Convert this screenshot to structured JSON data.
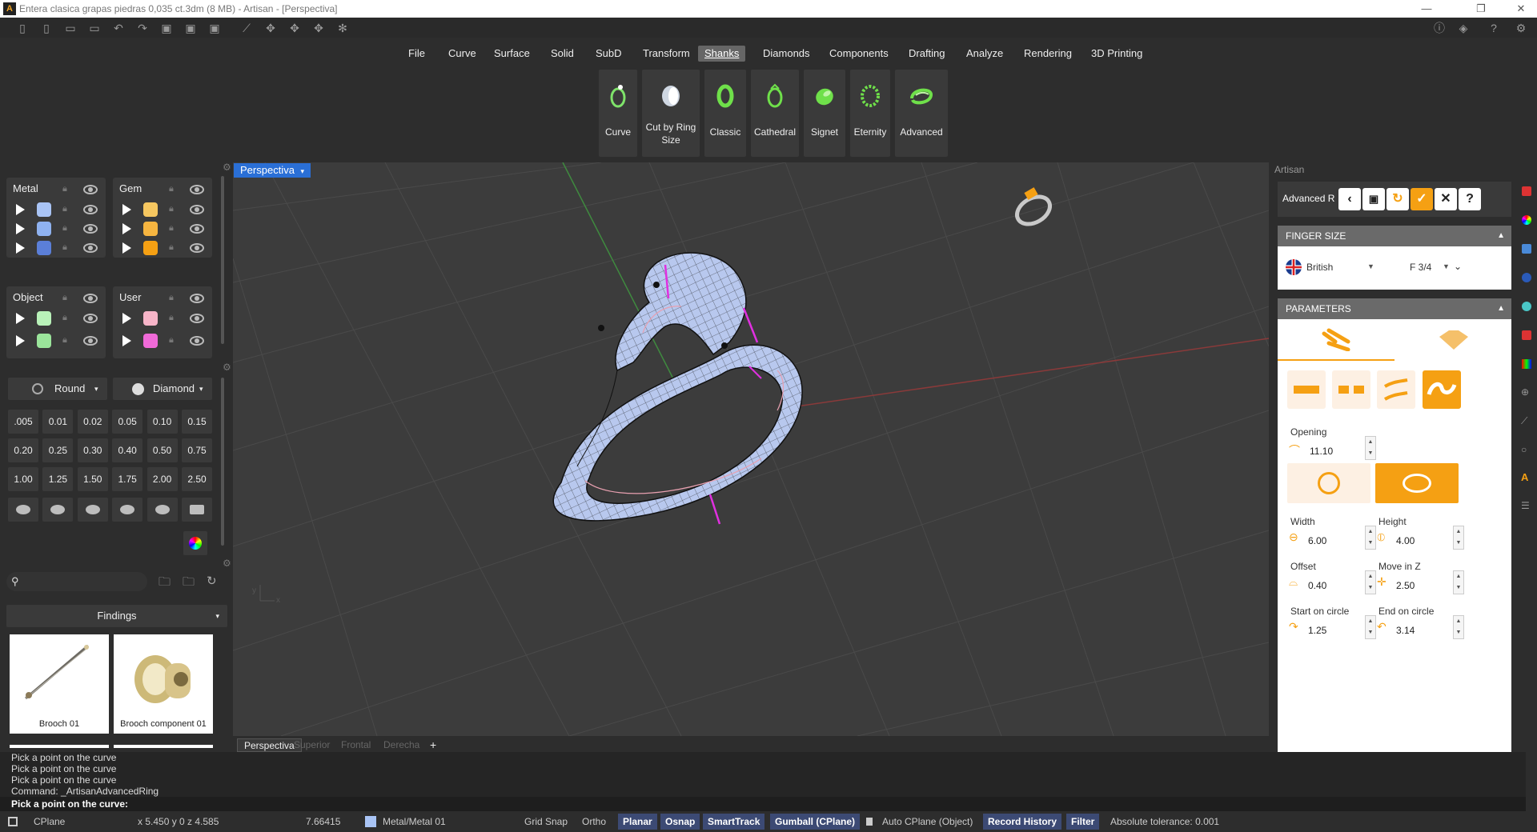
{
  "titlebar": {
    "title": "Entera clasica grapas piedras 0,035 ct.3dm (8 MB) - Artisan - [Perspectiva]"
  },
  "menu": [
    "File",
    "Curve",
    "Surface",
    "Solid",
    "SubD",
    "Transform",
    "Shanks",
    "Diamonds",
    "Components",
    "Drafting",
    "Analyze",
    "Rendering",
    "3D Printing"
  ],
  "menu_active": "Shanks",
  "ribbon": [
    {
      "label": "Curve",
      "icon": "ring-curve-icon"
    },
    {
      "label": "Cut by Ring Size",
      "icon": "ring-cut-icon"
    },
    {
      "label": "Classic",
      "icon": "ring-classic-icon"
    },
    {
      "label": "Cathedral",
      "icon": "ring-cathedral-icon"
    },
    {
      "label": "Signet",
      "icon": "ring-signet-icon"
    },
    {
      "label": "Eternity",
      "icon": "ring-eternity-icon"
    },
    {
      "label": "Advanced",
      "icon": "ring-advanced-icon"
    }
  ],
  "layers": {
    "metal": {
      "label": "Metal",
      "colors": [
        "#a9c4f5",
        "#8fb2f0",
        "#5b7fd8"
      ]
    },
    "gem": {
      "label": "Gem",
      "colors": [
        "#f6c760",
        "#f6b540",
        "#f5a013"
      ]
    },
    "object": {
      "label": "Object",
      "colors": [
        "#b9f2b9",
        "#9be59b"
      ]
    },
    "user": {
      "label": "User",
      "colors": [
        "#f7b5c8",
        "#f06ad8"
      ]
    }
  },
  "gems": {
    "shape": "Round",
    "cut": "Diamond",
    "sizes": [
      ".005",
      "0.01",
      "0.02",
      "0.05",
      "0.10",
      "0.15",
      "0.20",
      "0.25",
      "0.30",
      "0.40",
      "0.50",
      "0.75",
      "1.00",
      "1.25",
      "1.50",
      "1.75",
      "2.00",
      "2.50"
    ]
  },
  "library": {
    "category": "Findings",
    "items": [
      {
        "label": "Brooch 01"
      },
      {
        "label": "Brooch component 01"
      }
    ]
  },
  "viewport": {
    "name": "Perspectiva",
    "tabs": [
      "Perspectiva",
      "Superior",
      "Frontal",
      "Derecha"
    ],
    "active_tab": "Perspectiva",
    "axis_x": "x",
    "axis_y": "y"
  },
  "artisan": {
    "panel_title": "Artisan",
    "mode": "Advanced R",
    "finger_size": {
      "header": "FINGER SIZE",
      "system": "British",
      "size": "F 3/4"
    },
    "parameters": {
      "header": "PARAMETERS",
      "opening": {
        "label": "Opening",
        "value": "11.10"
      },
      "width": {
        "label": "Width",
        "value": "6.00"
      },
      "height": {
        "label": "Height",
        "value": "4.00"
      },
      "offset": {
        "label": "Offset",
        "value": "0.40"
      },
      "move_z": {
        "label": "Move in Z",
        "value": "2.50"
      },
      "start_circle": {
        "label": "Start on circle",
        "value": "1.25"
      },
      "end_circle": {
        "label": "End on circle",
        "value": "3.14"
      }
    }
  },
  "command_history": [
    "Pick a point on the curve",
    "Pick a point on the curve",
    "Pick a point on the curve",
    "Command: _ArtisanAdvancedRing"
  ],
  "prompt": "Pick a point on the curve:",
  "status": {
    "cplane": "CPlane",
    "coords": "x 5.450   y 0   z 4.585",
    "distance": "7.66415",
    "layer": "Metal/Metal 01",
    "grid_snap": "Grid Snap",
    "ortho": "Ortho",
    "planar": "Planar",
    "osnap": "Osnap",
    "smarttrack": "SmartTrack",
    "gumball": "Gumball (CPlane)",
    "auto_cplane": "Auto CPlane (Object)",
    "record_history": "Record History",
    "filter": "Filter",
    "tolerance": "Absolute tolerance: 0.001"
  },
  "colors": {
    "accent": "#f5a013",
    "viewport_tab": "#2a6fd6",
    "ring": "#b8c8ee",
    "status_on": "#3c4a74"
  }
}
